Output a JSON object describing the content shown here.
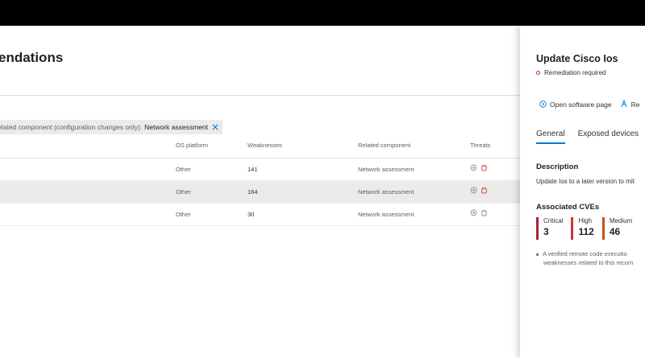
{
  "page": {
    "title": "endations"
  },
  "filter": {
    "key": "elated component (configuration changes only):",
    "value": "Network assessment"
  },
  "table": {
    "headers": {
      "os_platform": "OS platform",
      "weaknesses": "Weaknesses",
      "related_component": "Related component",
      "threats": "Threats"
    },
    "rows": [
      {
        "os_platform": "Other",
        "weaknesses": "141",
        "related_component": "Network assessment"
      },
      {
        "os_platform": "Other",
        "weaknesses": "164",
        "related_component": "Network assessment"
      },
      {
        "os_platform": "Other",
        "weaknesses": "30",
        "related_component": "Network assessment"
      }
    ]
  },
  "panel": {
    "title": "Update Cisco Ios",
    "status": "Remediation required",
    "actions": {
      "open_software": "Open software page",
      "second": "Re"
    },
    "tabs": {
      "general": "General",
      "exposed": "Exposed devices"
    },
    "description": {
      "heading": "Description",
      "text": "Update Ios to a later version to mit"
    },
    "cves": {
      "heading": "Associated CVEs",
      "critical_label": "Critical",
      "critical_value": "3",
      "high_label": "High",
      "high_value": "112",
      "medium_label": "Medium",
      "medium_value": "46"
    },
    "note": {
      "line1": "A verified remote code executio",
      "line2": "weaknesses related to this recom"
    }
  },
  "colors": {
    "accent": "#0078d4",
    "critical": "#a4262c",
    "high": "#d13438",
    "medium": "#ca5010",
    "threat": "#d13438"
  }
}
